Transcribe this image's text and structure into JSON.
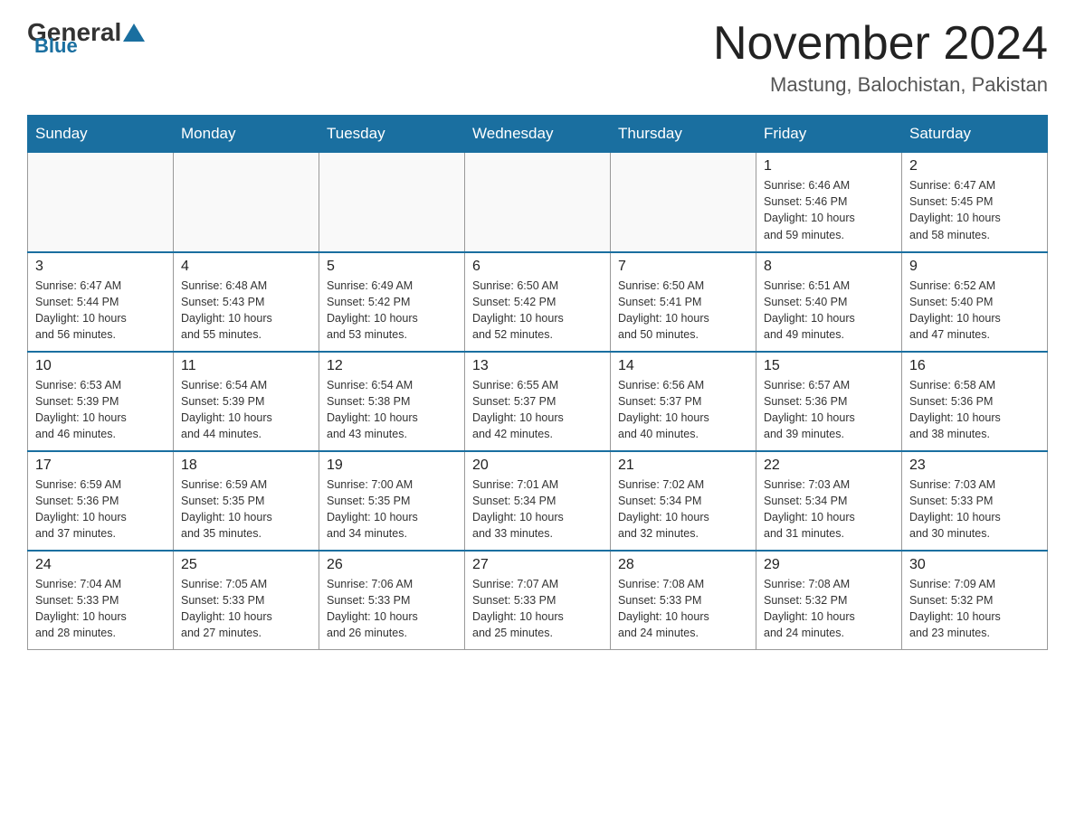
{
  "header": {
    "logo_general": "General",
    "logo_blue": "Blue",
    "month_title": "November 2024",
    "location": "Mastung, Balochistan, Pakistan"
  },
  "days_of_week": [
    "Sunday",
    "Monday",
    "Tuesday",
    "Wednesday",
    "Thursday",
    "Friday",
    "Saturday"
  ],
  "weeks": [
    [
      {
        "day": "",
        "info": ""
      },
      {
        "day": "",
        "info": ""
      },
      {
        "day": "",
        "info": ""
      },
      {
        "day": "",
        "info": ""
      },
      {
        "day": "",
        "info": ""
      },
      {
        "day": "1",
        "info": "Sunrise: 6:46 AM\nSunset: 5:46 PM\nDaylight: 10 hours\nand 59 minutes."
      },
      {
        "day": "2",
        "info": "Sunrise: 6:47 AM\nSunset: 5:45 PM\nDaylight: 10 hours\nand 58 minutes."
      }
    ],
    [
      {
        "day": "3",
        "info": "Sunrise: 6:47 AM\nSunset: 5:44 PM\nDaylight: 10 hours\nand 56 minutes."
      },
      {
        "day": "4",
        "info": "Sunrise: 6:48 AM\nSunset: 5:43 PM\nDaylight: 10 hours\nand 55 minutes."
      },
      {
        "day": "5",
        "info": "Sunrise: 6:49 AM\nSunset: 5:42 PM\nDaylight: 10 hours\nand 53 minutes."
      },
      {
        "day": "6",
        "info": "Sunrise: 6:50 AM\nSunset: 5:42 PM\nDaylight: 10 hours\nand 52 minutes."
      },
      {
        "day": "7",
        "info": "Sunrise: 6:50 AM\nSunset: 5:41 PM\nDaylight: 10 hours\nand 50 minutes."
      },
      {
        "day": "8",
        "info": "Sunrise: 6:51 AM\nSunset: 5:40 PM\nDaylight: 10 hours\nand 49 minutes."
      },
      {
        "day": "9",
        "info": "Sunrise: 6:52 AM\nSunset: 5:40 PM\nDaylight: 10 hours\nand 47 minutes."
      }
    ],
    [
      {
        "day": "10",
        "info": "Sunrise: 6:53 AM\nSunset: 5:39 PM\nDaylight: 10 hours\nand 46 minutes."
      },
      {
        "day": "11",
        "info": "Sunrise: 6:54 AM\nSunset: 5:39 PM\nDaylight: 10 hours\nand 44 minutes."
      },
      {
        "day": "12",
        "info": "Sunrise: 6:54 AM\nSunset: 5:38 PM\nDaylight: 10 hours\nand 43 minutes."
      },
      {
        "day": "13",
        "info": "Sunrise: 6:55 AM\nSunset: 5:37 PM\nDaylight: 10 hours\nand 42 minutes."
      },
      {
        "day": "14",
        "info": "Sunrise: 6:56 AM\nSunset: 5:37 PM\nDaylight: 10 hours\nand 40 minutes."
      },
      {
        "day": "15",
        "info": "Sunrise: 6:57 AM\nSunset: 5:36 PM\nDaylight: 10 hours\nand 39 minutes."
      },
      {
        "day": "16",
        "info": "Sunrise: 6:58 AM\nSunset: 5:36 PM\nDaylight: 10 hours\nand 38 minutes."
      }
    ],
    [
      {
        "day": "17",
        "info": "Sunrise: 6:59 AM\nSunset: 5:36 PM\nDaylight: 10 hours\nand 37 minutes."
      },
      {
        "day": "18",
        "info": "Sunrise: 6:59 AM\nSunset: 5:35 PM\nDaylight: 10 hours\nand 35 minutes."
      },
      {
        "day": "19",
        "info": "Sunrise: 7:00 AM\nSunset: 5:35 PM\nDaylight: 10 hours\nand 34 minutes."
      },
      {
        "day": "20",
        "info": "Sunrise: 7:01 AM\nSunset: 5:34 PM\nDaylight: 10 hours\nand 33 minutes."
      },
      {
        "day": "21",
        "info": "Sunrise: 7:02 AM\nSunset: 5:34 PM\nDaylight: 10 hours\nand 32 minutes."
      },
      {
        "day": "22",
        "info": "Sunrise: 7:03 AM\nSunset: 5:34 PM\nDaylight: 10 hours\nand 31 minutes."
      },
      {
        "day": "23",
        "info": "Sunrise: 7:03 AM\nSunset: 5:33 PM\nDaylight: 10 hours\nand 30 minutes."
      }
    ],
    [
      {
        "day": "24",
        "info": "Sunrise: 7:04 AM\nSunset: 5:33 PM\nDaylight: 10 hours\nand 28 minutes."
      },
      {
        "day": "25",
        "info": "Sunrise: 7:05 AM\nSunset: 5:33 PM\nDaylight: 10 hours\nand 27 minutes."
      },
      {
        "day": "26",
        "info": "Sunrise: 7:06 AM\nSunset: 5:33 PM\nDaylight: 10 hours\nand 26 minutes."
      },
      {
        "day": "27",
        "info": "Sunrise: 7:07 AM\nSunset: 5:33 PM\nDaylight: 10 hours\nand 25 minutes."
      },
      {
        "day": "28",
        "info": "Sunrise: 7:08 AM\nSunset: 5:33 PM\nDaylight: 10 hours\nand 24 minutes."
      },
      {
        "day": "29",
        "info": "Sunrise: 7:08 AM\nSunset: 5:32 PM\nDaylight: 10 hours\nand 24 minutes."
      },
      {
        "day": "30",
        "info": "Sunrise: 7:09 AM\nSunset: 5:32 PM\nDaylight: 10 hours\nand 23 minutes."
      }
    ]
  ]
}
